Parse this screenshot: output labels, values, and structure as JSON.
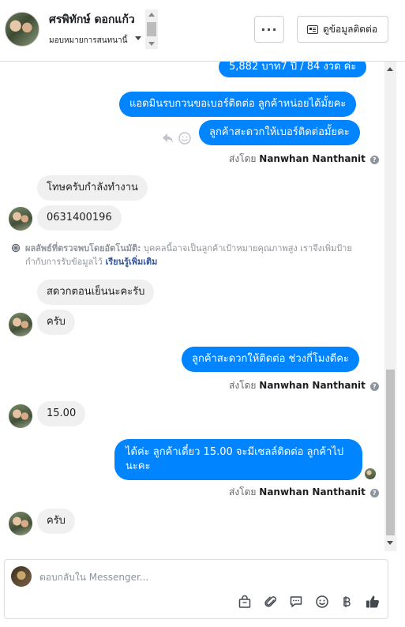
{
  "header": {
    "name": "ศรพิทักษ์ ดอกแก้ว",
    "subtitle": "มอบหมายการสนทนานี้",
    "more_label": "···",
    "contact_label": "ดูข้อมูลติดต่อ"
  },
  "messages": {
    "m1": "5,882 บาท7 ปี / 84 งวด ค่ะ",
    "m2": "แอดมินรบกวนขอเบอร์ติดต่อ ลูกค้าหน่อยได้มั้ยคะ",
    "m3": "ลูกค้าสะดวกให้เบอร์ติดต่อมั้ยคะ",
    "m4": "โทษครับกำลังทำงาน",
    "m5": "0631400196",
    "m6": "สดวกตอนเย็นนะคะรับ",
    "m7": "ครับ",
    "m8": "ลูกค้าสะดวกให้ติดต่อ ช่วงกี่โมงดีคะ",
    "m9": "15.00",
    "m10_line1": "ได้ค่ะ ลูกค้าเดี๋ยว 15.00 จะมีเซลล์ติดต่อ ลูกค้าไป",
    "m10_line2": "นะคะ",
    "m11": "ครับ"
  },
  "sent_by": {
    "prefix": "ส่งโดย",
    "name": "Nanwhan Nanthanit",
    "help": "?"
  },
  "notice": {
    "bold": "ผลลัพธ์ที่ตรวจพบโดยอัตโนมัติ:",
    "text": " บุคคลนี้อาจเป็นลูกค้าเป้าหมายคุณภาพสูง เราจึงเพิ่มป้ายกำกับการรับข้อมูลไว้ ",
    "link": "เรียนรู้เพิ่มเติม"
  },
  "composer": {
    "placeholder": "ตอบกลับใน Messenger..."
  },
  "icons": {
    "toolbar": [
      "shopping-bag-icon",
      "attachment-icon",
      "saved-reply-icon",
      "emoji-icon",
      "baht-icon",
      "thumbs-up-icon"
    ]
  },
  "colors": {
    "outgoing": "#0084ff",
    "incoming": "#f0f0f0",
    "link": "#385898"
  }
}
